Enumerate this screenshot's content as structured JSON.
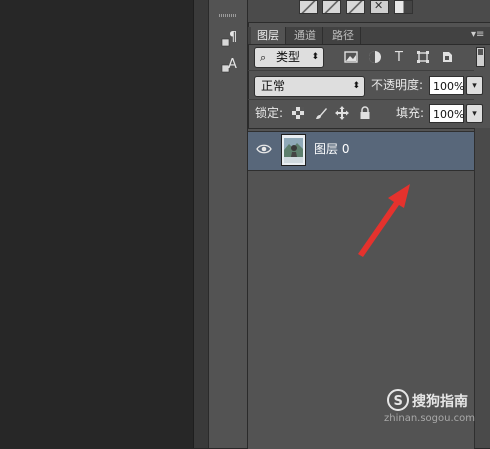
{
  "panel": {
    "tabs": [
      {
        "label": "图层",
        "active": true
      },
      {
        "label": "通道",
        "active": false
      },
      {
        "label": "路径",
        "active": false
      }
    ],
    "menu_glyph": "▾≡",
    "filter": {
      "search_glyph": "⌕",
      "label": "类型",
      "arrow_glyph": "⬍",
      "icons": [
        "image-filter-icon",
        "adjustment-filter-icon",
        "text-filter-icon",
        "shape-filter-icon",
        "smart-object-filter-icon"
      ],
      "text_icon_glyph": "T"
    },
    "blend": {
      "mode": "正常",
      "arrow_glyph": "⬍",
      "opacity_label": "不透明度:",
      "opacity_value": "100%",
      "dropdown_glyph": "▾"
    },
    "lock": {
      "label": "锁定:",
      "icons": [
        "lock-transparent-pixels-icon",
        "lock-image-pixels-icon",
        "lock-position-icon",
        "lock-all-icon"
      ],
      "fill_label": "填充:",
      "fill_value": "100%",
      "dropdown_glyph": "▾"
    },
    "layers": [
      {
        "name": "图层 0",
        "visible": true,
        "selected": true
      }
    ]
  },
  "tools": {
    "items": [
      "paragraph-style-icon",
      "character-style-icon"
    ],
    "paragraph_glyph": "¶",
    "character_glyph": "A"
  },
  "watermark": {
    "logo_glyph": "S",
    "text": "搜狗指南",
    "url": "zhinan.sogou.com"
  },
  "colors": {
    "selected_row": "#58677a",
    "arrow": "#e5322d",
    "panel_bg": "#535353"
  }
}
